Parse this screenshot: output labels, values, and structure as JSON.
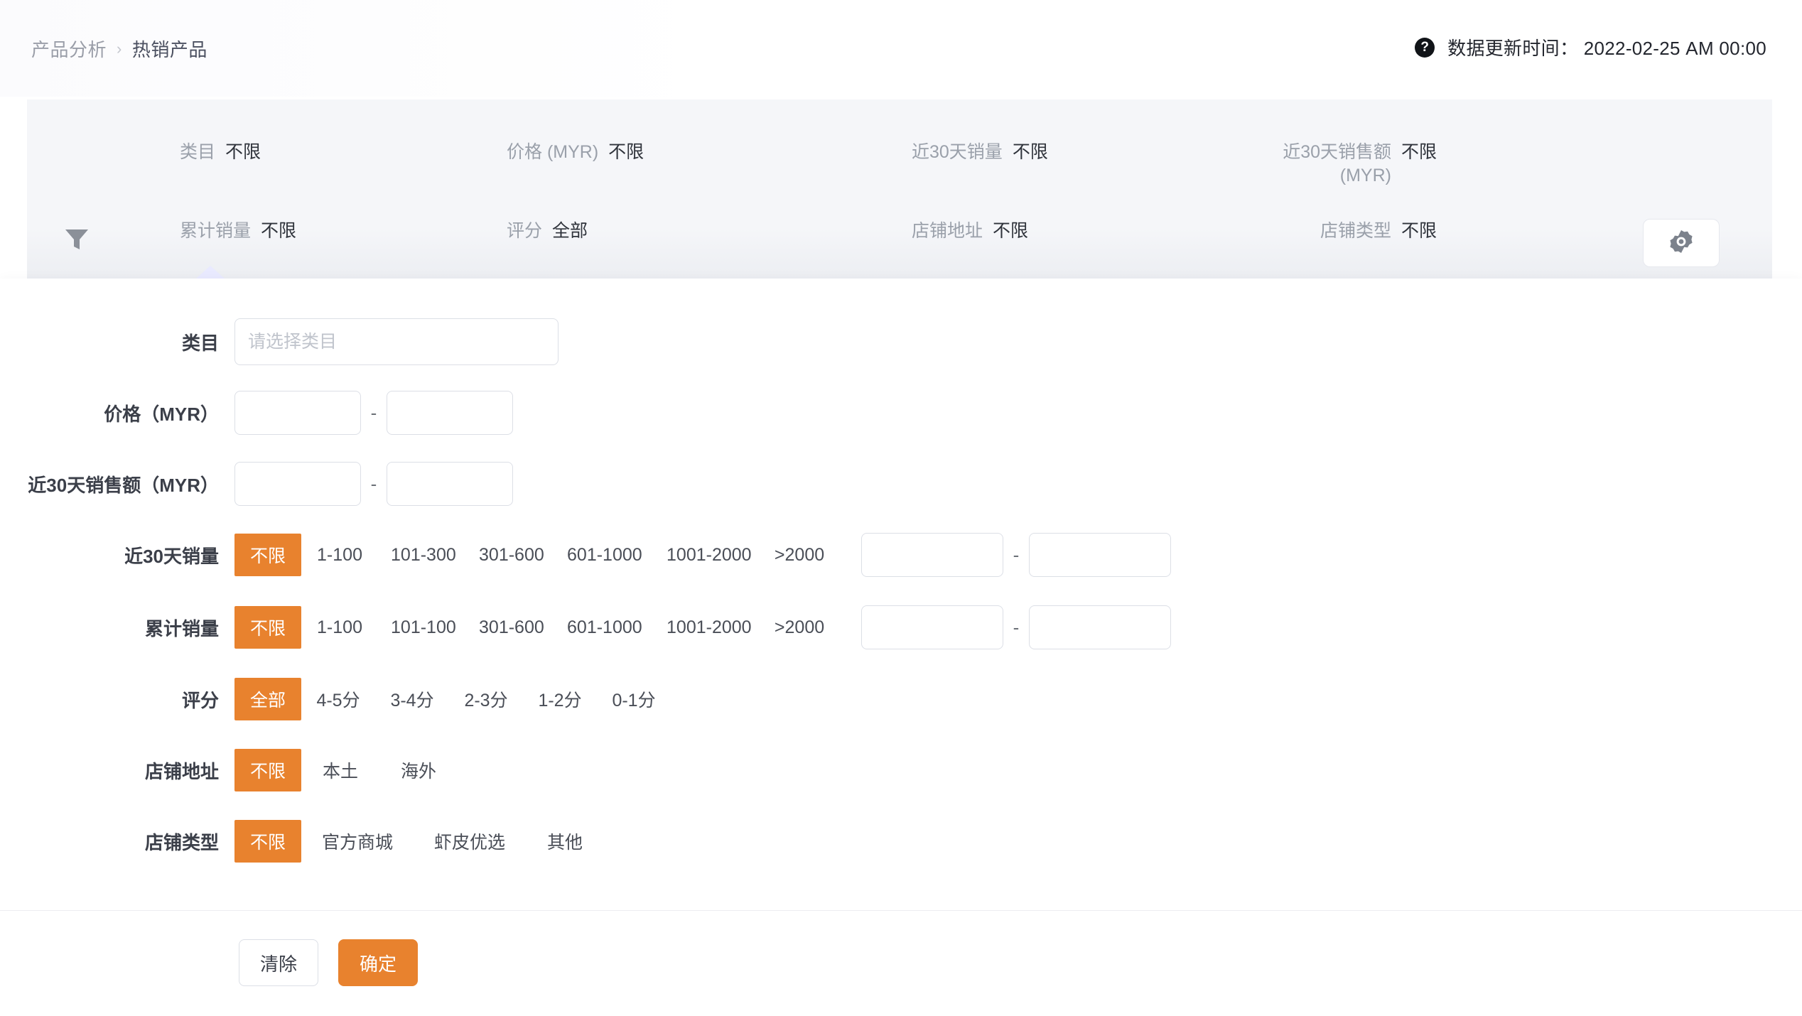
{
  "header": {
    "breadcrumb": {
      "parent": "产品分析",
      "separator": "›",
      "current": "热销产品"
    },
    "help_icon": "question-mark-icon",
    "update_label": "数据更新时间：",
    "update_time": "2022-02-25 AM 00:00",
    "update_full": "数据更新时间： 2022-02-25 AM 00:00"
  },
  "filter_bar": {
    "funnel_icon": "funnel-icon",
    "gear_icon": "gear-icon",
    "items": [
      {
        "label": "类目",
        "value": "不限"
      },
      {
        "label": "价格 (MYR)",
        "value": "不限"
      },
      {
        "label": "近30天销量",
        "value": "不限"
      },
      {
        "label": "近30天销售额\n(MYR)",
        "label_line1": "近30天销售额",
        "label_line2": "(MYR)",
        "value": "不限"
      },
      {
        "label": "累计销量",
        "value": "不限"
      },
      {
        "label": "评分",
        "value": "全部"
      },
      {
        "label": "店铺地址",
        "value": "不限"
      },
      {
        "label": "店铺类型",
        "value": "不限"
      }
    ]
  },
  "panel": {
    "category": {
      "label": "类目",
      "placeholder": "请选择类目",
      "value": ""
    },
    "price": {
      "label": "价格（MYR）",
      "min": "",
      "max": "",
      "separator": "-"
    },
    "sales30": {
      "label": "近30天销售额（MYR）",
      "min": "",
      "max": "",
      "separator": "-"
    },
    "volume30": {
      "label": "近30天销量",
      "options": [
        "不限",
        "1-100",
        "101-300",
        "301-600",
        "601-1000",
        "1001-2000",
        ">2000"
      ],
      "selected": "不限",
      "min": "",
      "max": "",
      "separator": "-"
    },
    "volume_total": {
      "label": "累计销量",
      "options": [
        "不限",
        "1-100",
        "101-100",
        "301-600",
        "601-1000",
        "1001-2000",
        ">2000"
      ],
      "selected": "不限",
      "min": "",
      "max": "",
      "separator": "-"
    },
    "score": {
      "label": "评分",
      "options": [
        "全部",
        "4-5分",
        "3-4分",
        "2-3分",
        "1-2分",
        "0-1分"
      ],
      "selected": "全部"
    },
    "shop_address": {
      "label": "店铺地址",
      "options": [
        "不限",
        "本土",
        "海外"
      ],
      "selected": "不限"
    },
    "shop_type": {
      "label": "店铺类型",
      "options": [
        "不限",
        "官方商城",
        "虾皮优选",
        "其他"
      ],
      "selected": "不限"
    },
    "actions": {
      "clear": "清除",
      "confirm": "确定"
    }
  },
  "colors": {
    "accent": "#e8822e",
    "filter_bar_bg": "#f5f6f9",
    "text_primary": "#3b3f49",
    "text_muted": "#9aa0aa",
    "caret": "#e9eaff"
  }
}
